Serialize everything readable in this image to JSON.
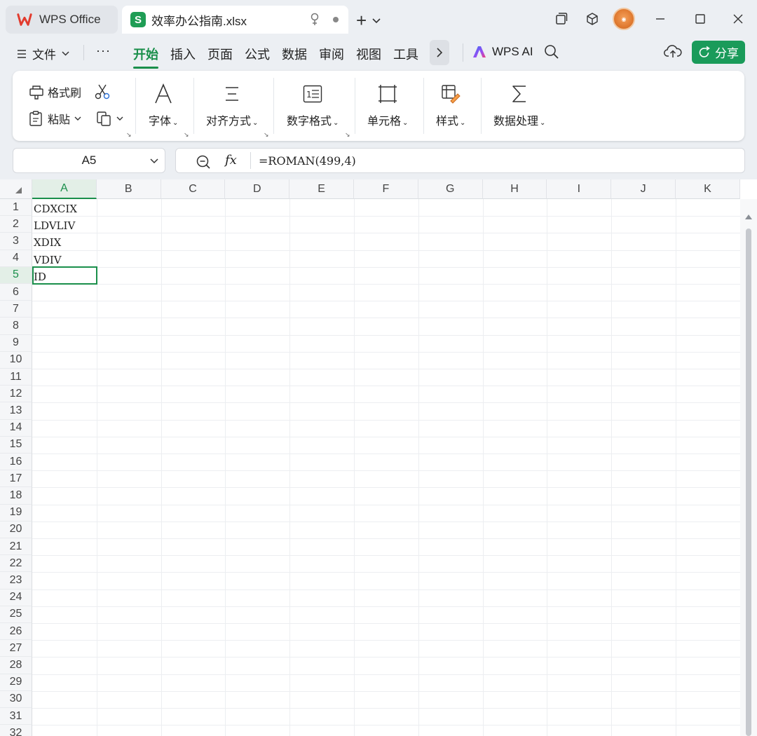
{
  "titlebar": {
    "app_tab": "WPS Office",
    "file_tab": "效率办公指南.xlsx",
    "new_tab": "+"
  },
  "menubar": {
    "file_menu": "文件",
    "more": "···",
    "tabs": [
      "开始",
      "插入",
      "页面",
      "公式",
      "数据",
      "审阅",
      "视图",
      "工具"
    ],
    "active_tab": "开始",
    "wps_ai": "WPS AI",
    "share": "分享"
  },
  "ribbon": {
    "format_painter": "格式刷",
    "paste": "粘贴",
    "font": "字体",
    "alignment": "对齐方式",
    "number_format": "数字格式",
    "cells": "单元格",
    "styles": "样式",
    "data_processing": "数据处理"
  },
  "formula_bar": {
    "name_box": "A5",
    "fx": "fx",
    "formula": "=ROMAN(499,4)"
  },
  "sheet": {
    "columns": [
      "A",
      "B",
      "C",
      "D",
      "E",
      "F",
      "G",
      "H",
      "I",
      "J",
      "K"
    ],
    "selected_column": "A",
    "rows": [
      "1",
      "2",
      "3",
      "4",
      "5",
      "6",
      "7",
      "8",
      "9",
      "10",
      "11",
      "12",
      "13",
      "14",
      "15",
      "16",
      "17",
      "18",
      "19",
      "20",
      "21",
      "22",
      "23",
      "24",
      "25",
      "26",
      "27",
      "28",
      "29",
      "30",
      "31",
      "32"
    ],
    "selected_row": "5",
    "cells_A": [
      "CDXCIX",
      "LDVLIV",
      "XDIX",
      "VDIV",
      "ID"
    ]
  },
  "colors": {
    "accent": "#1a8f4b",
    "share_button": "#1a9b5a",
    "file_icon": "#1f9d55"
  }
}
